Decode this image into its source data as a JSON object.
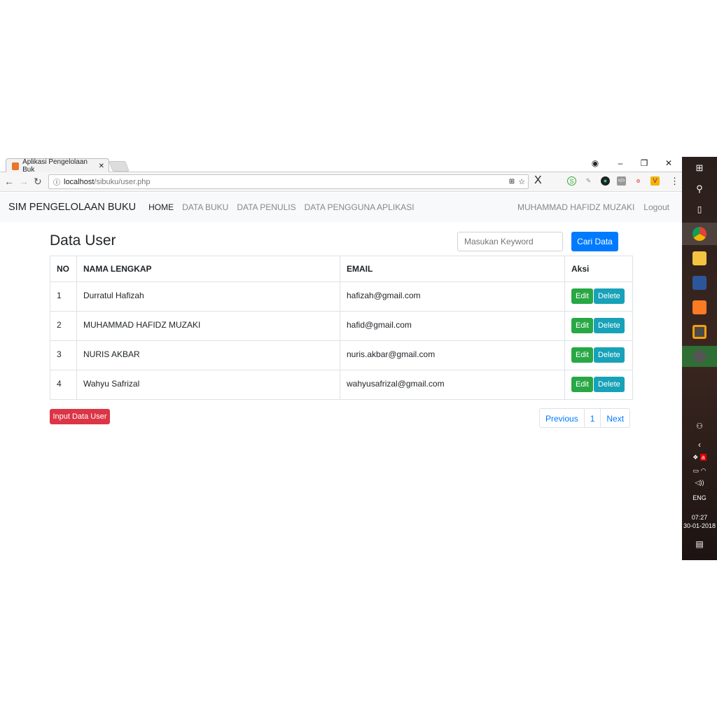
{
  "browser": {
    "tab_title": "Aplikasi Pengelolaan Buk",
    "url_host": "localhost",
    "url_path": "/sibuku/user.php",
    "extensions": [
      "S",
      "✎",
      "●",
      "</>",
      "ɵ",
      "V"
    ]
  },
  "navbar": {
    "brand": "SIM PENGELOLAAN BUKU",
    "links": [
      "HOME",
      "DATA BUKU",
      "DATA PENULIS",
      "DATA PENGGUNA APLIKASI"
    ],
    "user": "MUHAMMAD HAFIDZ MUZAKI",
    "logout": "Logout"
  },
  "page": {
    "title": "Data User",
    "search_placeholder": "Masukan Keyword",
    "search_button": "Cari Data",
    "input_button": "Input Data User"
  },
  "table": {
    "headers": [
      "NO",
      "NAMA LENGKAP",
      "EMAIL",
      "Aksi"
    ],
    "rows": [
      {
        "no": "1",
        "nama": "Durratul Hafizah",
        "email": "hafizah@gmail.com"
      },
      {
        "no": "2",
        "nama": "MUHAMMAD HAFIDZ MUZAKI",
        "email": "hafid@gmail.com"
      },
      {
        "no": "3",
        "nama": "NURIS AKBAR",
        "email": "nuris.akbar@gmail.com"
      },
      {
        "no": "4",
        "nama": "Wahyu Safrizal",
        "email": "wahyusafrizal@gmail.com"
      }
    ],
    "edit_label": "Edit",
    "delete_label": "Delete"
  },
  "pagination": {
    "previous": "Previous",
    "page": "1",
    "next": "Next"
  },
  "taskbar": {
    "lang": "ENG",
    "time": "07:27",
    "date": "30-01-2018"
  },
  "colors": {
    "primary": "#007bff",
    "success": "#28a745",
    "info": "#17a2b8",
    "danger": "#dc3545"
  }
}
